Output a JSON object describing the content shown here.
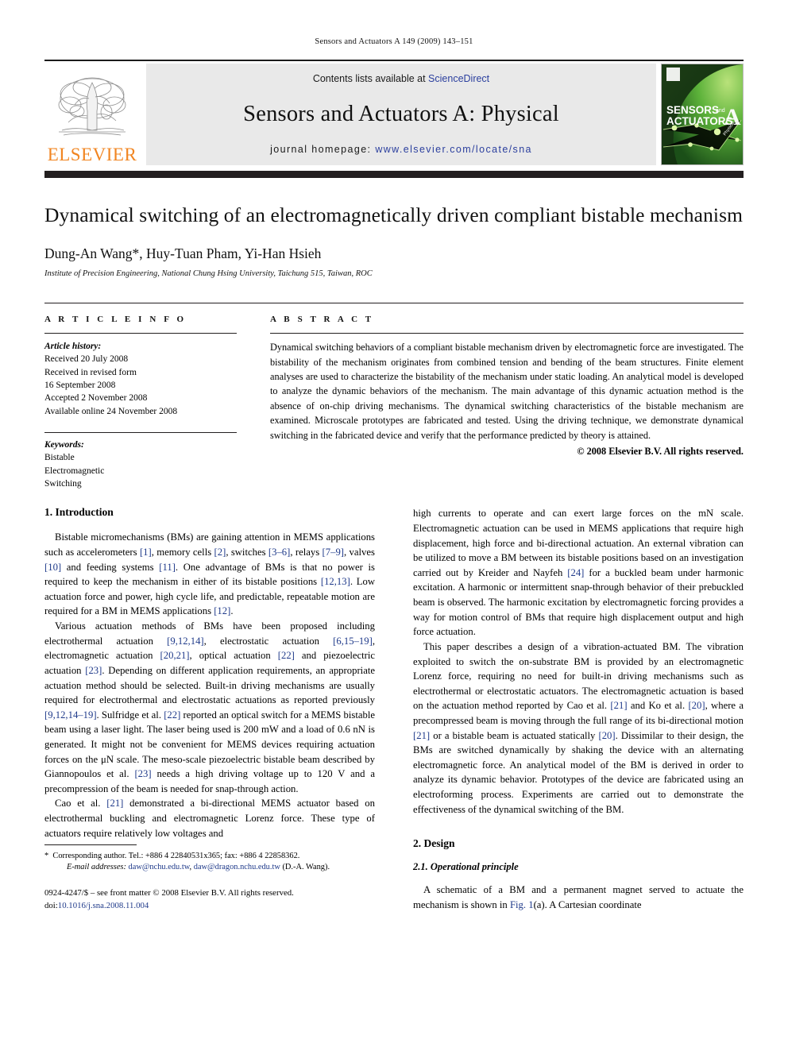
{
  "running_head": "Sensors and Actuators A 149 (2009) 143–151",
  "masthead": {
    "elsevier_wordmark": "ELSEVIER",
    "contents_prefix": "Contents lists available at ",
    "contents_link": "ScienceDirect",
    "journal_name": "Sensors and Actuators A: Physical",
    "homepage_prefix": "journal homepage: ",
    "homepage_url": "www.elsevier.com/locate/sna",
    "cover_title_line1": "SENSORS",
    "cover_title_and": "and",
    "cover_title_line2": "ACTUATORS",
    "cover_letter": "A",
    "cover_sub": "Physical",
    "accent_orange": "#F18521",
    "link_blue": "#2b3f9e",
    "cover_green": "#3faa35"
  },
  "title": "Dynamical switching of an electromagnetically driven compliant bistable mechanism",
  "authors": "Dung-An Wang*, Huy-Tuan Pham, Yi-Han Hsieh",
  "affiliation": "Institute of Precision Engineering, National Chung Hsing University, Taichung 515, Taiwan, ROC",
  "article_info": {
    "heading": "A R T I C L E   I N F O",
    "history_label": "Article history:",
    "history": [
      "Received 20 July 2008",
      "Received in revised form",
      "16 September 2008",
      "Accepted 2 November 2008",
      "Available online 24 November 2008"
    ],
    "keywords_label": "Keywords:",
    "keywords": [
      "Bistable",
      "Electromagnetic",
      "Switching"
    ]
  },
  "abstract": {
    "heading": "A B S T R A C T",
    "text": "Dynamical switching behaviors of a compliant bistable mechanism driven by electromagnetic force are investigated. The bistability of the mechanism originates from combined tension and bending of the beam structures. Finite element analyses are used to characterize the bistability of the mechanism under static loading. An analytical model is developed to analyze the dynamic behaviors of the mechanism. The main advantage of this dynamic actuation method is the absence of on-chip driving mechanisms. The dynamical switching characteristics of the bistable mechanism are examined. Microscale prototypes are fabricated and tested. Using the driving technique, we demonstrate dynamical switching in the fabricated device and verify that the performance predicted by theory is attained.",
    "copyright": "© 2008 Elsevier B.V. All rights reserved."
  },
  "sections": {
    "introduction_heading": "1.  Introduction",
    "design_heading": "2.  Design",
    "operational_heading": "2.1.  Operational principle"
  },
  "left_column": {
    "p1_a": "Bistable micromechanisms (BMs) are gaining attention in MEMS applications such as accelerometers ",
    "p1_r1": "[1]",
    "p1_b": ", memory cells ",
    "p1_r2": "[2]",
    "p1_c": ", switches ",
    "p1_r3": "[3–6]",
    "p1_d": ", relays ",
    "p1_r4": "[7–9]",
    "p1_e": ", valves ",
    "p1_r5": "[10]",
    "p1_f": " and feeding systems ",
    "p1_r6": "[11]",
    "p1_g": ". One advantage of BMs is that no power is required to keep the mechanism in either of its bistable positions ",
    "p1_r7": "[12,13]",
    "p1_h": ". Low actuation force and power, high cycle life, and predictable, repeatable motion are required for a BM in MEMS applications ",
    "p1_r8": "[12]",
    "p1_i": ".",
    "p2_a": "Various actuation methods of BMs have been proposed including electrothermal actuation ",
    "p2_r1": "[9,12,14]",
    "p2_b": ", electrostatic actuation ",
    "p2_r2": "[6,15–19]",
    "p2_c": ", electromagnetic actuation ",
    "p2_r3": "[20,21]",
    "p2_d": ", optical actuation ",
    "p2_r4": "[22]",
    "p2_e": " and piezoelectric actuation ",
    "p2_r5": "[23]",
    "p2_f": ". Depending on different application requirements, an appropriate actuation method should be selected. Built-in driving mechanisms are usually required for electrothermal and electrostatic actuations as reported previously ",
    "p2_r6": "[9,12,14–19]",
    "p2_g": ". Sulfridge et al. ",
    "p2_r7": "[22]",
    "p2_h": " reported an optical switch for a MEMS bistable beam using a laser light. The laser being used is 200 mW and a load of 0.6 nN is generated. It might not be convenient for MEMS devices requiring actuation forces on the μN scale. The meso-scale piezoelectric bistable beam described by Giannopoulos et al. ",
    "p2_r8": "[23]",
    "p2_i": " needs a high driving voltage up to 120 V and a precompression of the beam is needed for snap-through action.",
    "p3_a": "Cao et al. ",
    "p3_r1": "[21]",
    "p3_b": " demonstrated a bi-directional MEMS actuator based on electrothermal buckling and electromagnetic Lorenz force. These type of actuators require relatively low voltages and"
  },
  "right_column": {
    "p1_a": "high currents to operate and can exert large forces on the mN scale. Electromagnetic actuation can be used in MEMS applications that require high displacement, high force and bi-directional actuation. An external vibration can be utilized to move a BM between its bistable positions based on an investigation carried out by Kreider and Nayfeh ",
    "p1_r1": "[24]",
    "p1_b": " for a buckled beam under harmonic excitation. A harmonic or intermittent snap-through behavior of their prebuckled beam is observed. The harmonic excitation by electromagnetic forcing provides a way for motion control of BMs that require high displacement output and high force actuation.",
    "p2_a": "This paper describes a design of a vibration-actuated BM. The vibration exploited to switch the on-substrate BM is provided by an electromagnetic Lorenz force, requiring no need for built-in driving mechanisms such as electrothermal or electrostatic actuators. The electromagnetic actuation is based on the actuation method reported by Cao et al. ",
    "p2_r1": "[21]",
    "p2_b": " and Ko et al. ",
    "p2_r2": "[20]",
    "p2_c": ", where a precompressed beam is moving through the full range of its bi-directional motion ",
    "p2_r3": "[21]",
    "p2_d": " or a bistable beam is actuated statically ",
    "p2_r4": "[20]",
    "p2_e": ". Dissimilar to their design, the BMs are switched dynamically by shaking the device with an alternating electromagnetic force. An analytical model of the BM is derived in order to analyze its dynamic behavior. Prototypes of the device are fabricated using an electroforming process. Experiments are carried out to demonstrate the effectiveness of the dynamical switching of the BM.",
    "p3_a": "A schematic of a BM and a permanent magnet served to actuate the mechanism is shown in ",
    "p3_r1": "Fig. 1",
    "p3_b": "(a). A Cartesian coordinate"
  },
  "footnote": {
    "marker": "*",
    "corresponding": "Corresponding author. Tel.: +886 4 22840531x365; fax: +886 4 22858362.",
    "email_label": "E-mail addresses:",
    "email1": "daw@nchu.edu.tw",
    "email_sep": ", ",
    "email2": "daw@dragon.nchu.edu.tw",
    "email_suffix": " (D.-A. Wang).",
    "issn_line": "0924-4247/$ – see front matter © 2008 Elsevier B.V. All rights reserved.",
    "doi_label": "doi:",
    "doi_value": "10.1016/j.sna.2008.11.004"
  }
}
